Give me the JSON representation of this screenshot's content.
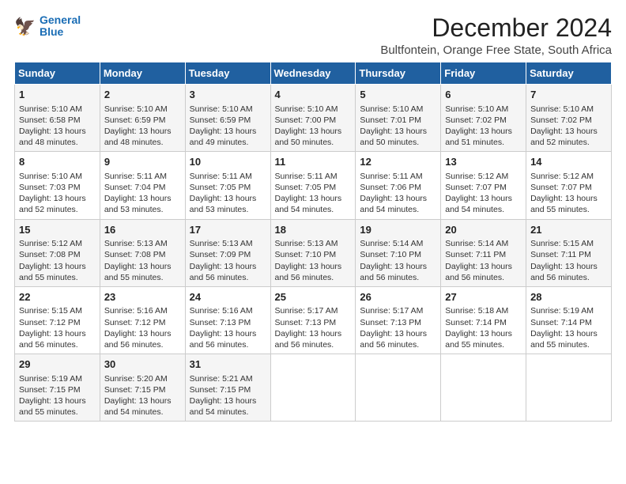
{
  "logo": {
    "line1": "General",
    "line2": "Blue"
  },
  "title": "December 2024",
  "subtitle": "Bultfontein, Orange Free State, South Africa",
  "days_of_week": [
    "Sunday",
    "Monday",
    "Tuesday",
    "Wednesday",
    "Thursday",
    "Friday",
    "Saturday"
  ],
  "weeks": [
    [
      {
        "day": "1",
        "sunrise": "Sunrise: 5:10 AM",
        "sunset": "Sunset: 6:58 PM",
        "daylight": "Daylight: 13 hours and 48 minutes."
      },
      {
        "day": "2",
        "sunrise": "Sunrise: 5:10 AM",
        "sunset": "Sunset: 6:59 PM",
        "daylight": "Daylight: 13 hours and 48 minutes."
      },
      {
        "day": "3",
        "sunrise": "Sunrise: 5:10 AM",
        "sunset": "Sunset: 6:59 PM",
        "daylight": "Daylight: 13 hours and 49 minutes."
      },
      {
        "day": "4",
        "sunrise": "Sunrise: 5:10 AM",
        "sunset": "Sunset: 7:00 PM",
        "daylight": "Daylight: 13 hours and 50 minutes."
      },
      {
        "day": "5",
        "sunrise": "Sunrise: 5:10 AM",
        "sunset": "Sunset: 7:01 PM",
        "daylight": "Daylight: 13 hours and 50 minutes."
      },
      {
        "day": "6",
        "sunrise": "Sunrise: 5:10 AM",
        "sunset": "Sunset: 7:02 PM",
        "daylight": "Daylight: 13 hours and 51 minutes."
      },
      {
        "day": "7",
        "sunrise": "Sunrise: 5:10 AM",
        "sunset": "Sunset: 7:02 PM",
        "daylight": "Daylight: 13 hours and 52 minutes."
      }
    ],
    [
      {
        "day": "8",
        "sunrise": "Sunrise: 5:10 AM",
        "sunset": "Sunset: 7:03 PM",
        "daylight": "Daylight: 13 hours and 52 minutes."
      },
      {
        "day": "9",
        "sunrise": "Sunrise: 5:11 AM",
        "sunset": "Sunset: 7:04 PM",
        "daylight": "Daylight: 13 hours and 53 minutes."
      },
      {
        "day": "10",
        "sunrise": "Sunrise: 5:11 AM",
        "sunset": "Sunset: 7:05 PM",
        "daylight": "Daylight: 13 hours and 53 minutes."
      },
      {
        "day": "11",
        "sunrise": "Sunrise: 5:11 AM",
        "sunset": "Sunset: 7:05 PM",
        "daylight": "Daylight: 13 hours and 54 minutes."
      },
      {
        "day": "12",
        "sunrise": "Sunrise: 5:11 AM",
        "sunset": "Sunset: 7:06 PM",
        "daylight": "Daylight: 13 hours and 54 minutes."
      },
      {
        "day": "13",
        "sunrise": "Sunrise: 5:12 AM",
        "sunset": "Sunset: 7:07 PM",
        "daylight": "Daylight: 13 hours and 54 minutes."
      },
      {
        "day": "14",
        "sunrise": "Sunrise: 5:12 AM",
        "sunset": "Sunset: 7:07 PM",
        "daylight": "Daylight: 13 hours and 55 minutes."
      }
    ],
    [
      {
        "day": "15",
        "sunrise": "Sunrise: 5:12 AM",
        "sunset": "Sunset: 7:08 PM",
        "daylight": "Daylight: 13 hours and 55 minutes."
      },
      {
        "day": "16",
        "sunrise": "Sunrise: 5:13 AM",
        "sunset": "Sunset: 7:08 PM",
        "daylight": "Daylight: 13 hours and 55 minutes."
      },
      {
        "day": "17",
        "sunrise": "Sunrise: 5:13 AM",
        "sunset": "Sunset: 7:09 PM",
        "daylight": "Daylight: 13 hours and 56 minutes."
      },
      {
        "day": "18",
        "sunrise": "Sunrise: 5:13 AM",
        "sunset": "Sunset: 7:10 PM",
        "daylight": "Daylight: 13 hours and 56 minutes."
      },
      {
        "day": "19",
        "sunrise": "Sunrise: 5:14 AM",
        "sunset": "Sunset: 7:10 PM",
        "daylight": "Daylight: 13 hours and 56 minutes."
      },
      {
        "day": "20",
        "sunrise": "Sunrise: 5:14 AM",
        "sunset": "Sunset: 7:11 PM",
        "daylight": "Daylight: 13 hours and 56 minutes."
      },
      {
        "day": "21",
        "sunrise": "Sunrise: 5:15 AM",
        "sunset": "Sunset: 7:11 PM",
        "daylight": "Daylight: 13 hours and 56 minutes."
      }
    ],
    [
      {
        "day": "22",
        "sunrise": "Sunrise: 5:15 AM",
        "sunset": "Sunset: 7:12 PM",
        "daylight": "Daylight: 13 hours and 56 minutes."
      },
      {
        "day": "23",
        "sunrise": "Sunrise: 5:16 AM",
        "sunset": "Sunset: 7:12 PM",
        "daylight": "Daylight: 13 hours and 56 minutes."
      },
      {
        "day": "24",
        "sunrise": "Sunrise: 5:16 AM",
        "sunset": "Sunset: 7:13 PM",
        "daylight": "Daylight: 13 hours and 56 minutes."
      },
      {
        "day": "25",
        "sunrise": "Sunrise: 5:17 AM",
        "sunset": "Sunset: 7:13 PM",
        "daylight": "Daylight: 13 hours and 56 minutes."
      },
      {
        "day": "26",
        "sunrise": "Sunrise: 5:17 AM",
        "sunset": "Sunset: 7:13 PM",
        "daylight": "Daylight: 13 hours and 56 minutes."
      },
      {
        "day": "27",
        "sunrise": "Sunrise: 5:18 AM",
        "sunset": "Sunset: 7:14 PM",
        "daylight": "Daylight: 13 hours and 55 minutes."
      },
      {
        "day": "28",
        "sunrise": "Sunrise: 5:19 AM",
        "sunset": "Sunset: 7:14 PM",
        "daylight": "Daylight: 13 hours and 55 minutes."
      }
    ],
    [
      {
        "day": "29",
        "sunrise": "Sunrise: 5:19 AM",
        "sunset": "Sunset: 7:15 PM",
        "daylight": "Daylight: 13 hours and 55 minutes."
      },
      {
        "day": "30",
        "sunrise": "Sunrise: 5:20 AM",
        "sunset": "Sunset: 7:15 PM",
        "daylight": "Daylight: 13 hours and 54 minutes."
      },
      {
        "day": "31",
        "sunrise": "Sunrise: 5:21 AM",
        "sunset": "Sunset: 7:15 PM",
        "daylight": "Daylight: 13 hours and 54 minutes."
      },
      null,
      null,
      null,
      null
    ]
  ]
}
